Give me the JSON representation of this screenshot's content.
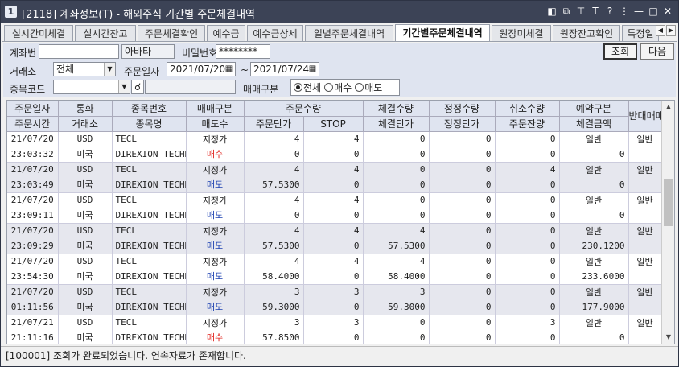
{
  "window": {
    "title": "[2118] 계좌정보(T) - 해외주식 기간별 주문체결내역",
    "app_icon": "1"
  },
  "tabs": [
    "실시간미체결",
    "실시간잔고",
    "주문체결확인",
    "예수금",
    "예수금상세",
    "일별주문체결내역",
    "기간별주문체결내역",
    "원장미체결",
    "원장잔고확인",
    "특정일"
  ],
  "active_tab": "기간별주문체결내역",
  "form": {
    "account_label": "계좌번",
    "account_value": "",
    "account_name": "아바타",
    "password_label": "비밀번호",
    "password_value": "********",
    "query_button": "조회",
    "next_button": "다음",
    "exchange_label": "거래소",
    "exchange_value": "전체",
    "order_date_label": "주문일자",
    "date_from": "2021/07/20",
    "date_sep": "~",
    "date_to": "2021/07/24",
    "stock_code_label": "종목코드",
    "stock_code_value": "",
    "stock_name_value": "",
    "trade_type_label": "매매구분",
    "trade_options": [
      "전체",
      "매수",
      "매도"
    ],
    "trade_selected": "전체"
  },
  "grid": {
    "headers_top": [
      "주문일자",
      "통화",
      "종목번호",
      "매매구분",
      "주문수량",
      "",
      "체결수량",
      "정정수량",
      "취소수량",
      "예약구분",
      "반대매매"
    ],
    "headers_bottom": [
      "주문시간",
      "거래소",
      "종목명",
      "매도수",
      "주문단가",
      "STOP",
      "체결단가",
      "정정단가",
      "주문잔량",
      "체결금액"
    ],
    "rows": [
      {
        "date": "21/07/20",
        "time": "23:03:32",
        "currency": "USD",
        "exchange": "미국",
        "code": "TECL",
        "name": "DIREXION TECHN",
        "type": "지정가",
        "side": "매수",
        "qty": "4",
        "stop_qty": "4",
        "exec_qty": "0",
        "mod_qty": "0",
        "cancel_qty": "0",
        "price": "0",
        "stop": "0",
        "exec_price": "0",
        "mod_price": "0",
        "remain": "0",
        "reserve": "일반",
        "amount": "0",
        "counter": "일반"
      },
      {
        "date": "21/07/20",
        "time": "23:03:49",
        "currency": "USD",
        "exchange": "미국",
        "code": "TECL",
        "name": "DIREXION TECHN",
        "type": "지정가",
        "side": "매도",
        "qty": "4",
        "stop_qty": "4",
        "exec_qty": "0",
        "mod_qty": "0",
        "cancel_qty": "4",
        "price": "57.5300",
        "stop": "0",
        "exec_price": "0",
        "mod_price": "0",
        "remain": "0",
        "reserve": "일반",
        "amount": "0",
        "counter": "일반"
      },
      {
        "date": "21/07/20",
        "time": "23:09:11",
        "currency": "USD",
        "exchange": "미국",
        "code": "TECL",
        "name": "DIREXION TECHN",
        "type": "지정가",
        "side": "매도",
        "qty": "4",
        "stop_qty": "4",
        "exec_qty": "0",
        "mod_qty": "0",
        "cancel_qty": "0",
        "price": "0",
        "stop": "0",
        "exec_price": "0",
        "mod_price": "0",
        "remain": "0",
        "reserve": "일반",
        "amount": "0",
        "counter": "일반"
      },
      {
        "date": "21/07/20",
        "time": "23:09:29",
        "currency": "USD",
        "exchange": "미국",
        "code": "TECL",
        "name": "DIREXION TECHN",
        "type": "지정가",
        "side": "매도",
        "qty": "4",
        "stop_qty": "4",
        "exec_qty": "4",
        "mod_qty": "0",
        "cancel_qty": "0",
        "price": "57.5300",
        "stop": "0",
        "exec_price": "57.5300",
        "mod_price": "0",
        "remain": "0",
        "reserve": "일반",
        "amount": "230.1200",
        "counter": "일반"
      },
      {
        "date": "21/07/20",
        "time": "23:54:30",
        "currency": "USD",
        "exchange": "미국",
        "code": "TECL",
        "name": "DIREXION TECHN",
        "type": "지정가",
        "side": "매도",
        "qty": "4",
        "stop_qty": "4",
        "exec_qty": "4",
        "mod_qty": "0",
        "cancel_qty": "0",
        "price": "58.4000",
        "stop": "0",
        "exec_price": "58.4000",
        "mod_price": "0",
        "remain": "0",
        "reserve": "일반",
        "amount": "233.6000",
        "counter": "일반"
      },
      {
        "date": "21/07/20",
        "time": "01:11:56",
        "currency": "USD",
        "exchange": "미국",
        "code": "TECL",
        "name": "DIREXION TECHN",
        "type": "지정가",
        "side": "매도",
        "qty": "3",
        "stop_qty": "3",
        "exec_qty": "3",
        "mod_qty": "0",
        "cancel_qty": "0",
        "price": "59.3000",
        "stop": "0",
        "exec_price": "59.3000",
        "mod_price": "0",
        "remain": "0",
        "reserve": "일반",
        "amount": "177.9000",
        "counter": "일반"
      },
      {
        "date": "21/07/21",
        "time": "21:11:16",
        "currency": "USD",
        "exchange": "미국",
        "code": "TECL",
        "name": "DIREXION TECHN",
        "type": "지정가",
        "side": "매수",
        "qty": "3",
        "stop_qty": "3",
        "exec_qty": "0",
        "mod_qty": "0",
        "cancel_qty": "3",
        "price": "57.8500",
        "stop": "0",
        "exec_price": "0",
        "mod_price": "0",
        "remain": "0",
        "reserve": "일반",
        "amount": "0",
        "counter": "일반"
      }
    ]
  },
  "status": "[100001] 조회가 완료되었습니다. 연속자료가 존재합니다.",
  "colors": {
    "title_bg": "#3c4356",
    "form_bg": "#dfe4f0",
    "buy": "#e0201a",
    "sell": "#1a3fb0",
    "row_alt": "#e6e7ee"
  }
}
